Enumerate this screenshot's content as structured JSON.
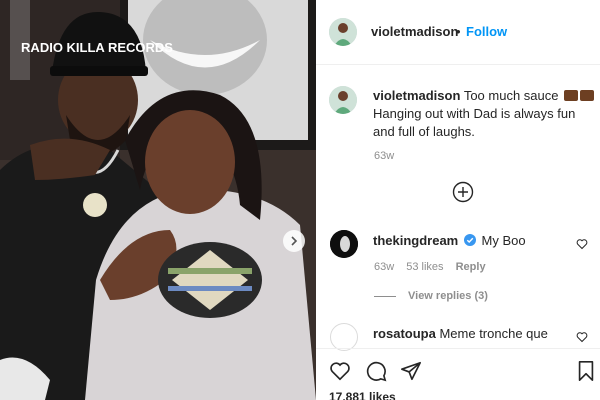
{
  "post": {
    "author": "violetmadison",
    "follow_label": "Follow",
    "dot": "•",
    "caption_user": "violetmadison",
    "caption_text": "Too much sauce",
    "caption_text2": "Hanging out with Dad is always fun and full of laughs.",
    "caption_age": "63w",
    "cap_text": "RADIO KILLA RECORDS"
  },
  "comments": [
    {
      "user": "thekingdream",
      "text": "My Boo",
      "verified": true,
      "age": "63w",
      "likes": "53 likes",
      "reply_label": "Reply",
      "view_replies": "View replies (3)"
    },
    {
      "user": "rosatoupa",
      "text": "Meme tronche que"
    }
  ],
  "actions": {
    "likes_count": "17,881 likes"
  },
  "icons": [
    "chevron-right-icon",
    "plus-circle-icon",
    "heart-icon",
    "comment-icon",
    "share-icon",
    "bookmark-icon",
    "verified-badge-icon"
  ],
  "colors": {
    "link": "#0095f6",
    "text": "#262626",
    "muted": "#8e8e8e",
    "verified": "#3897f0"
  }
}
